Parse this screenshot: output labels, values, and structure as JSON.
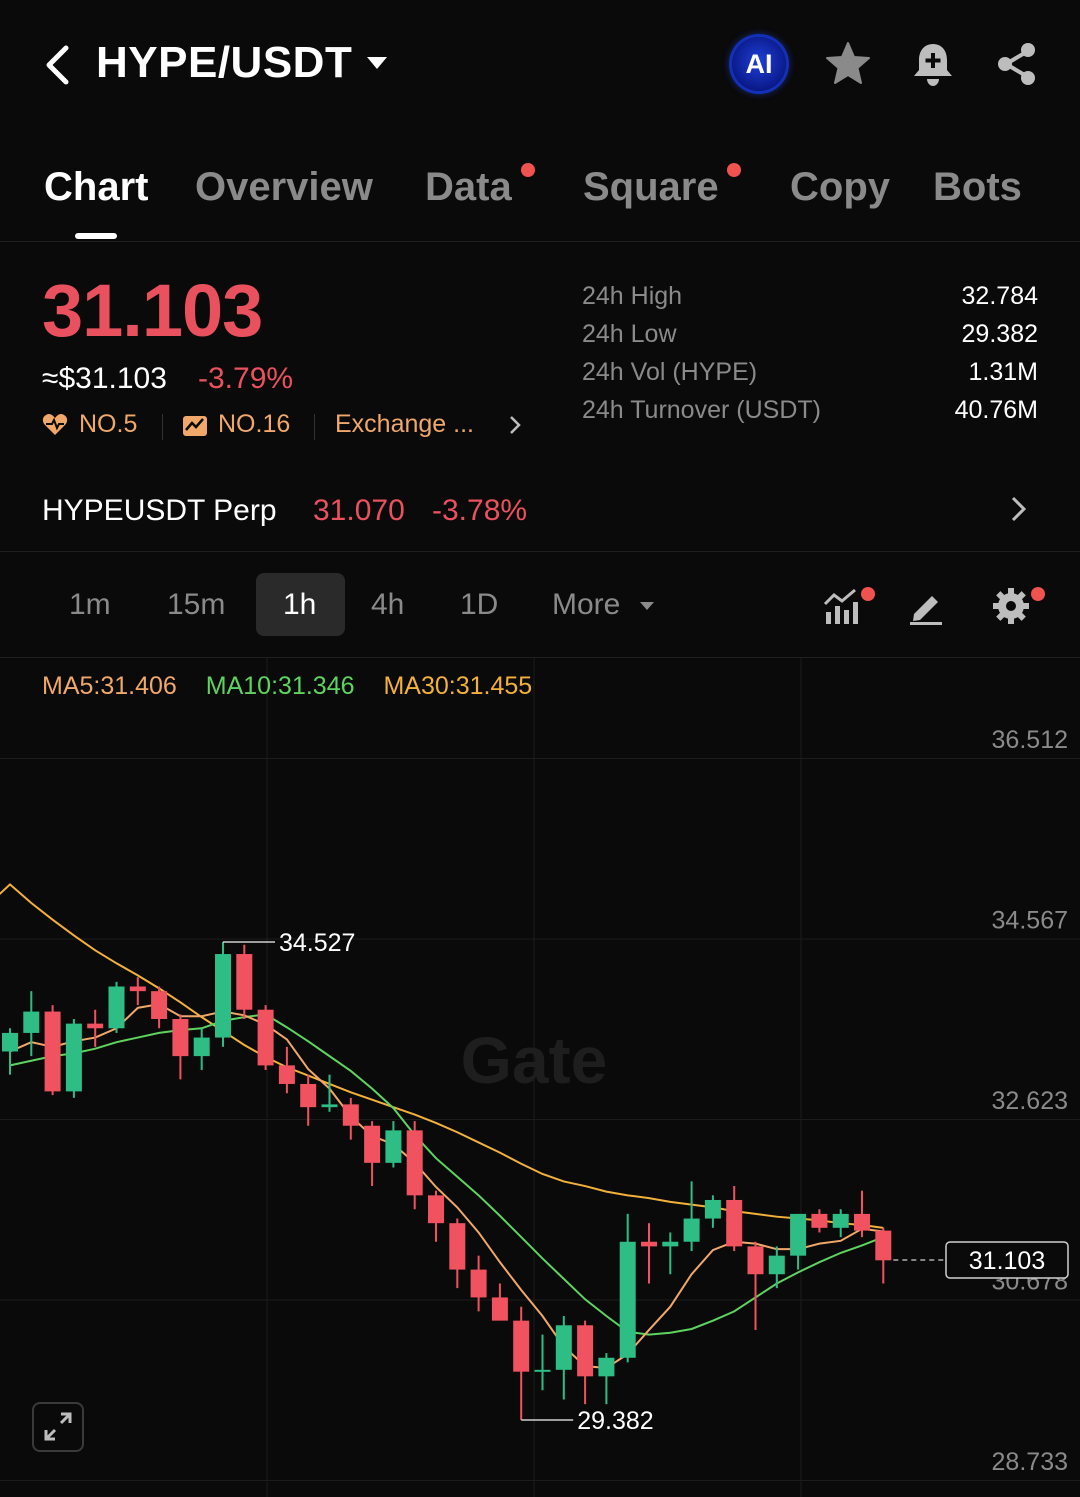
{
  "header": {
    "pair": "HYPE/USDT",
    "ai_label": "AI"
  },
  "tabs": [
    {
      "label": "Chart",
      "active": true,
      "dot": false
    },
    {
      "label": "Overview",
      "active": false,
      "dot": false
    },
    {
      "label": "Data",
      "active": false,
      "dot": true
    },
    {
      "label": "Square",
      "active": false,
      "dot": true
    },
    {
      "label": "Copy",
      "active": false,
      "dot": false
    },
    {
      "label": "Bots",
      "active": false,
      "dot": false
    }
  ],
  "price": {
    "last": "31.103",
    "usd": "≈$31.103",
    "change": "-3.79%",
    "rank_1": "NO.5",
    "rank_2": "NO.16",
    "exchange": "Exchange ..."
  },
  "stats": [
    {
      "label": "24h High",
      "value": "32.784"
    },
    {
      "label": "24h Low",
      "value": "29.382"
    },
    {
      "label": "24h Vol (HYPE)",
      "value": "1.31M"
    },
    {
      "label": "24h Turnover (USDT)",
      "value": "40.76M"
    }
  ],
  "perp": {
    "name": "HYPEUSDT Perp",
    "price": "31.070",
    "change": "-3.78%"
  },
  "intervals": {
    "items": [
      "1m",
      "15m",
      "1h",
      "4h",
      "1D"
    ],
    "active": "1h",
    "more": "More"
  },
  "colors": {
    "up": "#2ebd85",
    "down": "#f0525f",
    "ma5": "#f0a86a",
    "ma10": "#5fd35f",
    "ma30": "#f2b13a"
  },
  "ma": {
    "ma5": "MA5:31.406",
    "ma10": "MA10:31.346",
    "ma30": "MA30:31.455"
  },
  "chart_data": {
    "type": "candlestick",
    "y_ticks": [
      "36.512",
      "34.567",
      "32.623",
      "30.678",
      "28.733"
    ],
    "ylim": [
      28.733,
      36.512
    ],
    "high_label": "34.527",
    "low_label": "29.382",
    "last_price_label": "31.103",
    "watermark": "Gate",
    "candles": [
      {
        "o": 33.35,
        "h": 33.6,
        "l": 33.1,
        "c": 33.55
      },
      {
        "o": 33.55,
        "h": 34.0,
        "l": 33.3,
        "c": 33.78
      },
      {
        "o": 33.78,
        "h": 33.85,
        "l": 32.88,
        "c": 32.92
      },
      {
        "o": 32.92,
        "h": 33.7,
        "l": 32.85,
        "c": 33.65
      },
      {
        "o": 33.65,
        "h": 33.8,
        "l": 33.4,
        "c": 33.6
      },
      {
        "o": 33.6,
        "h": 34.1,
        "l": 33.55,
        "c": 34.05
      },
      {
        "o": 34.05,
        "h": 34.15,
        "l": 33.85,
        "c": 34.0
      },
      {
        "o": 34.0,
        "h": 34.05,
        "l": 33.6,
        "c": 33.7
      },
      {
        "o": 33.7,
        "h": 33.75,
        "l": 33.05,
        "c": 33.3
      },
      {
        "o": 33.3,
        "h": 33.6,
        "l": 33.15,
        "c": 33.5
      },
      {
        "o": 33.5,
        "h": 34.53,
        "l": 33.4,
        "c": 34.4
      },
      {
        "o": 34.4,
        "h": 34.5,
        "l": 33.7,
        "c": 33.8
      },
      {
        "o": 33.8,
        "h": 33.85,
        "l": 33.15,
        "c": 33.2
      },
      {
        "o": 33.2,
        "h": 33.4,
        "l": 32.9,
        "c": 33.0
      },
      {
        "o": 33.0,
        "h": 33.1,
        "l": 32.55,
        "c": 32.75
      },
      {
        "o": 32.75,
        "h": 33.1,
        "l": 32.7,
        "c": 32.78
      },
      {
        "o": 32.78,
        "h": 32.85,
        "l": 32.4,
        "c": 32.55
      },
      {
        "o": 32.55,
        "h": 32.6,
        "l": 31.9,
        "c": 32.15
      },
      {
        "o": 32.15,
        "h": 32.6,
        "l": 32.1,
        "c": 32.5
      },
      {
        "o": 32.5,
        "h": 32.6,
        "l": 31.65,
        "c": 31.8
      },
      {
        "o": 31.8,
        "h": 31.85,
        "l": 31.3,
        "c": 31.5
      },
      {
        "o": 31.5,
        "h": 31.55,
        "l": 30.8,
        "c": 31.0
      },
      {
        "o": 31.0,
        "h": 31.15,
        "l": 30.55,
        "c": 30.7
      },
      {
        "o": 30.7,
        "h": 30.85,
        "l": 30.5,
        "c": 30.45
      },
      {
        "o": 30.45,
        "h": 30.6,
        "l": 29.38,
        "c": 29.9
      },
      {
        "o": 29.9,
        "h": 30.3,
        "l": 29.7,
        "c": 29.92
      },
      {
        "o": 29.92,
        "h": 30.5,
        "l": 29.6,
        "c": 30.4
      },
      {
        "o": 30.4,
        "h": 30.45,
        "l": 29.55,
        "c": 29.85
      },
      {
        "o": 29.85,
        "h": 30.1,
        "l": 29.55,
        "c": 30.05
      },
      {
        "o": 30.05,
        "h": 31.6,
        "l": 30.0,
        "c": 31.3
      },
      {
        "o": 31.3,
        "h": 31.5,
        "l": 30.85,
        "c": 31.25
      },
      {
        "o": 31.25,
        "h": 31.4,
        "l": 30.95,
        "c": 31.3
      },
      {
        "o": 31.3,
        "h": 31.95,
        "l": 31.2,
        "c": 31.55
      },
      {
        "o": 31.55,
        "h": 31.8,
        "l": 31.45,
        "c": 31.75
      },
      {
        "o": 31.75,
        "h": 31.9,
        "l": 31.2,
        "c": 31.25
      },
      {
        "o": 31.25,
        "h": 31.3,
        "l": 30.35,
        "c": 30.95
      },
      {
        "o": 30.95,
        "h": 31.25,
        "l": 30.8,
        "c": 31.15
      },
      {
        "o": 31.15,
        "h": 31.6,
        "l": 31.0,
        "c": 31.6
      },
      {
        "o": 31.6,
        "h": 31.65,
        "l": 31.4,
        "c": 31.45
      },
      {
        "o": 31.45,
        "h": 31.65,
        "l": 31.35,
        "c": 31.6
      },
      {
        "o": 31.6,
        "h": 31.85,
        "l": 31.35,
        "c": 31.42
      },
      {
        "o": 31.42,
        "h": 31.45,
        "l": 30.85,
        "c": 31.1
      }
    ],
    "ma5": [
      33.35,
      33.45,
      33.4,
      33.46,
      33.5,
      33.6,
      33.82,
      33.86,
      33.73,
      33.73,
      33.78,
      33.74,
      33.64,
      33.48,
      33.16,
      32.95,
      32.65,
      32.44,
      32.35,
      32.15,
      31.89,
      31.67,
      31.4,
      31.08,
      30.78,
      30.5,
      30.17,
      29.96,
      29.94,
      30.09,
      30.35,
      30.6,
      30.95,
      31.21,
      31.3,
      31.28,
      31.22,
      31.22,
      31.28,
      31.31,
      31.44,
      31.41
    ],
    "ma10": [
      33.2,
      33.25,
      33.3,
      33.33,
      33.38,
      33.45,
      33.5,
      33.55,
      33.58,
      33.6,
      33.68,
      33.72,
      33.75,
      33.61,
      33.46,
      33.3,
      33.14,
      32.95,
      32.74,
      32.45,
      32.2,
      32.0,
      31.8,
      31.58,
      31.35,
      31.12,
      30.9,
      30.68,
      30.5,
      30.33,
      30.3,
      30.32,
      30.36,
      30.45,
      30.55,
      30.7,
      30.85,
      30.97,
      31.08,
      31.18,
      31.26,
      31.35
    ],
    "ma30": [
      35.15,
      34.95,
      34.77,
      34.6,
      34.44,
      34.3,
      34.17,
      34.03,
      33.88,
      33.72,
      33.57,
      33.42,
      33.29,
      33.18,
      33.09,
      33.0,
      32.91,
      32.83,
      32.75,
      32.67,
      32.58,
      32.48,
      32.37,
      32.26,
      32.14,
      32.03,
      31.95,
      31.9,
      31.84,
      31.8,
      31.77,
      31.73,
      31.7,
      31.67,
      31.63,
      31.6,
      31.57,
      31.55,
      31.53,
      31.5,
      31.48,
      31.45
    ]
  }
}
